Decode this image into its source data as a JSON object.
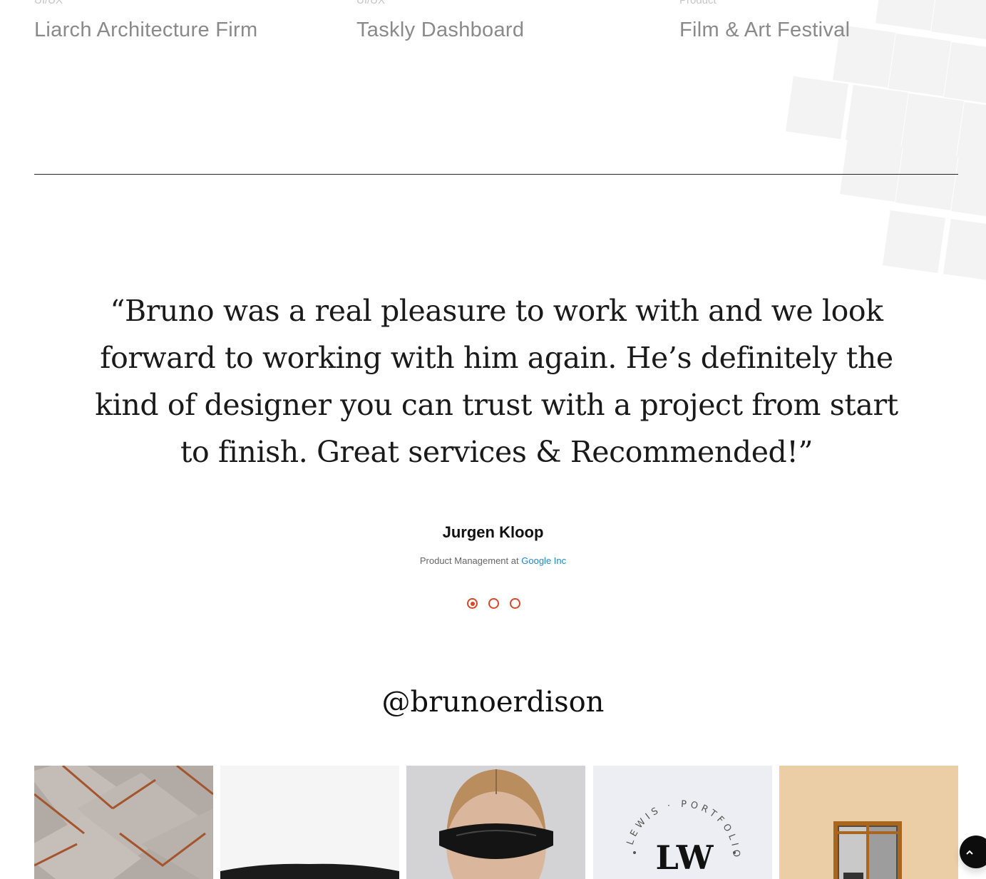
{
  "projects": [
    {
      "category": "UI/UX",
      "title": "Liarch Architecture Firm"
    },
    {
      "category": "UI/UX",
      "title": "Taskly Dashboard"
    },
    {
      "category": "Product",
      "title": "Film & Art Festival"
    }
  ],
  "testimonial": {
    "quote": "“Bruno was a real pleasure to work with and we look forward to working with him again. He’s definitely the kind of designer you can trust with a project from start to finish. Great services & Recommended!”",
    "author": "Jurgen Kloop",
    "role": "Product Management",
    "at": "at",
    "company": "Google Inc",
    "company_color": "#1e88c9",
    "slides_total": 3,
    "slide_active": 1,
    "dot_color": "#d9472b"
  },
  "instagram": {
    "handle": "@brunoerdison",
    "logo_tile": {
      "monogram": "LW",
      "ring_text": "LEWIS PORTFOLIO"
    }
  },
  "scroll_top": {
    "icon": "chevron-up-icon"
  }
}
